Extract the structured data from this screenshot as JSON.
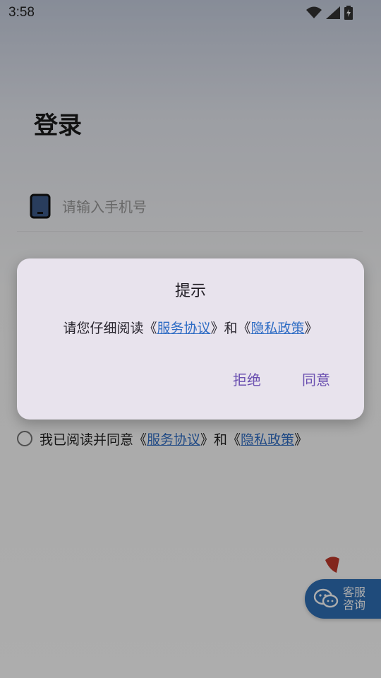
{
  "status_bar": {
    "time": "3:58"
  },
  "login": {
    "title": "登录",
    "phone_placeholder": "请输入手机号",
    "agreement": {
      "prefix": "我已阅读并同意《",
      "service_link": "服务协议",
      "middle": "》和《",
      "privacy_link": "隐私政策",
      "suffix": "》"
    }
  },
  "customer_service": {
    "label": "客服咨询"
  },
  "dialog": {
    "title": "提示",
    "message_prefix": "请您仔细阅读《",
    "service_link": "服务协议",
    "message_middle": "》和《",
    "privacy_link": "隐私政策",
    "message_suffix": "》",
    "reject_label": "拒绝",
    "agree_label": "同意"
  },
  "colors": {
    "link": "#2e6cc4",
    "dialog_action": "#6a4fb0",
    "cs_button": "#2f6fb5"
  }
}
